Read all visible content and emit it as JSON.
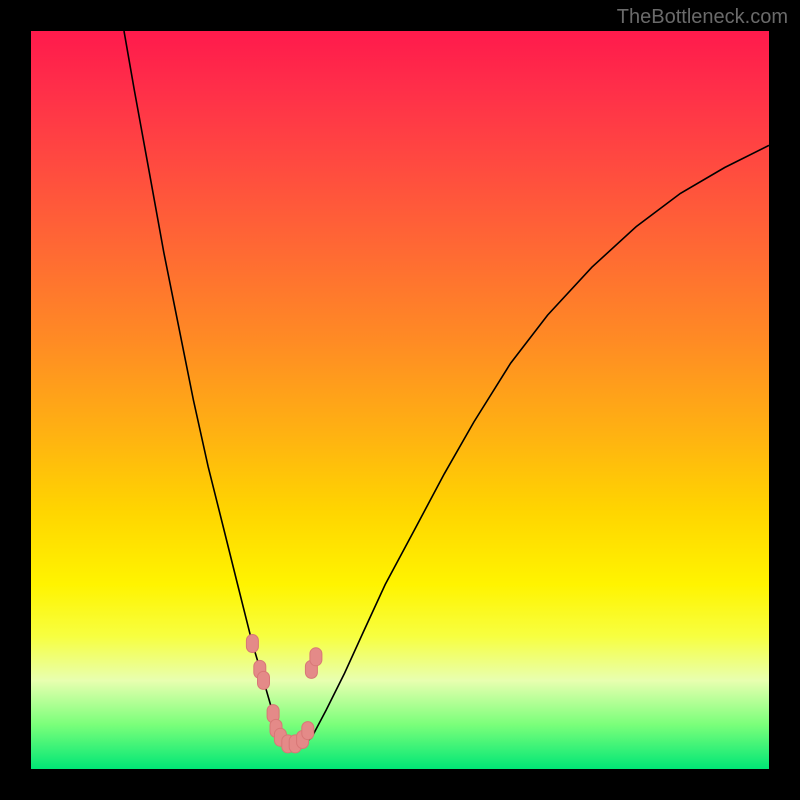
{
  "attribution": "TheBottleneck.com",
  "chart_data": {
    "type": "line",
    "title": "",
    "xlabel": "",
    "ylabel": "",
    "xlim": [
      0,
      100
    ],
    "ylim": [
      0,
      100
    ],
    "grid": false,
    "legend": false,
    "note": "Bottleneck-style V curve; background encodes quality (green near minimum, red far from it). Numeric axes are not labeled in the source image; values below are pixel-relative percentages across the 738×738 plot area.",
    "series": [
      {
        "name": "bottleneck-curve",
        "x_pct": [
          12.6,
          14.0,
          16.0,
          18.0,
          20.0,
          22.0,
          24.0,
          26.0,
          28.0,
          30.0,
          31.5,
          32.8,
          33.8,
          35.0,
          36.5,
          38.0,
          40.0,
          42.5,
          45.0,
          48.0,
          52.0,
          56.0,
          60.0,
          65.0,
          70.0,
          76.0,
          82.0,
          88.0,
          94.0,
          100.0
        ],
        "y_pct_from_top": [
          0.0,
          8.0,
          19.0,
          30.0,
          40.0,
          50.0,
          59.0,
          67.0,
          75.0,
          83.0,
          88.0,
          92.5,
          95.5,
          96.8,
          96.8,
          95.8,
          92.0,
          87.0,
          81.5,
          75.0,
          67.5,
          60.0,
          53.0,
          45.0,
          38.5,
          32.0,
          26.5,
          22.0,
          18.5,
          15.5
        ]
      }
    ],
    "min_markers_pct": [
      {
        "x": 30.0,
        "y_from_top": 83.0
      },
      {
        "x": 31.0,
        "y_from_top": 86.5
      },
      {
        "x": 31.5,
        "y_from_top": 88.0
      },
      {
        "x": 38.0,
        "y_from_top": 86.5
      },
      {
        "x": 38.6,
        "y_from_top": 84.8
      },
      {
        "x": 32.8,
        "y_from_top": 92.5
      },
      {
        "x": 33.2,
        "y_from_top": 94.5
      },
      {
        "x": 33.8,
        "y_from_top": 95.7
      },
      {
        "x": 34.8,
        "y_from_top": 96.6
      },
      {
        "x": 35.8,
        "y_from_top": 96.6
      },
      {
        "x": 36.8,
        "y_from_top": 96.0
      },
      {
        "x": 37.5,
        "y_from_top": 94.8
      }
    ]
  }
}
